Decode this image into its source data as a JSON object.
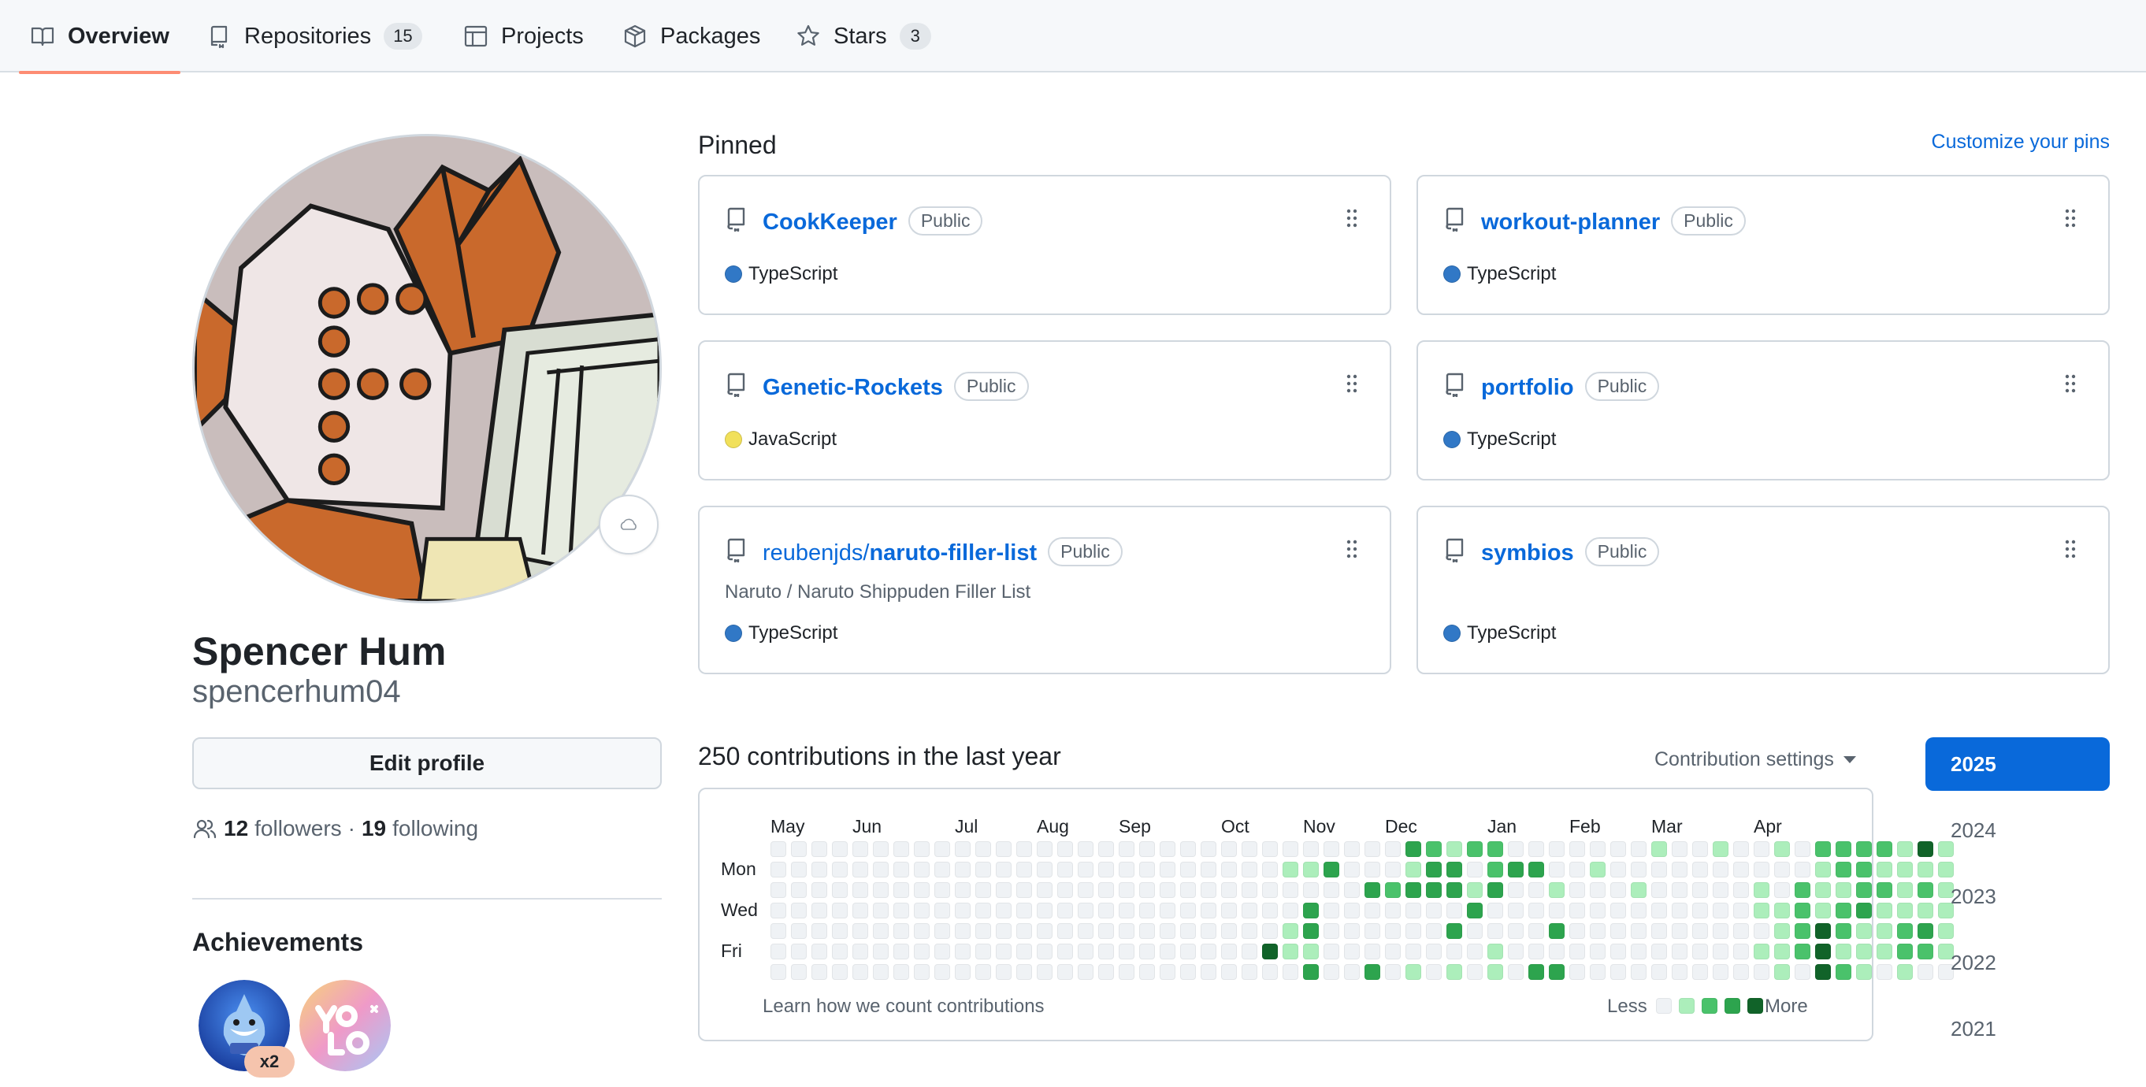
{
  "nav": {
    "tabs": [
      {
        "label": "Overview",
        "icon": "book-icon",
        "active": true
      },
      {
        "label": "Repositories",
        "icon": "repo-icon",
        "count": "15"
      },
      {
        "label": "Projects",
        "icon": "table-icon"
      },
      {
        "label": "Packages",
        "icon": "package-icon"
      },
      {
        "label": "Stars",
        "icon": "star-icon",
        "count": "3"
      }
    ]
  },
  "profile": {
    "name": "Spencer Hum",
    "login": "spencerhum04",
    "edit_label": "Edit profile",
    "followers_count": "12",
    "followers_label": "followers",
    "separator": "·",
    "following_count": "19",
    "following_label": "following",
    "achievements_title": "Achievements",
    "achievements": [
      {
        "name": "shark-badge",
        "count": "x2"
      },
      {
        "name": "yolo-badge"
      }
    ]
  },
  "pinned": {
    "title": "Pinned",
    "customize_label": "Customize your pins",
    "repos": [
      {
        "owner": "",
        "name": "CookKeeper",
        "visibility": "Public",
        "description": "",
        "language": "TypeScript",
        "lang_color": "#3178c6"
      },
      {
        "owner": "",
        "name": "workout-planner",
        "visibility": "Public",
        "description": "",
        "language": "TypeScript",
        "lang_color": "#3178c6"
      },
      {
        "owner": "",
        "name": "Genetic-Rockets",
        "visibility": "Public",
        "description": "",
        "language": "JavaScript",
        "lang_color": "#f1e05a"
      },
      {
        "owner": "",
        "name": "portfolio",
        "visibility": "Public",
        "description": "",
        "language": "TypeScript",
        "lang_color": "#3178c6"
      },
      {
        "owner": "reubenjds/",
        "name": "naruto-filler-list",
        "visibility": "Public",
        "description": "Naruto / Naruto Shippuden Filler List",
        "language": "TypeScript",
        "lang_color": "#3178c6"
      },
      {
        "owner": "",
        "name": "symbios",
        "visibility": "Public",
        "description": "",
        "language": "TypeScript",
        "lang_color": "#3178c6"
      }
    ]
  },
  "contributions": {
    "title": "250 contributions in the last year",
    "settings_label": "Contribution settings",
    "months": [
      "May",
      "Jun",
      "Jul",
      "Aug",
      "Sep",
      "Oct",
      "Nov",
      "Dec",
      "Jan",
      "Feb",
      "Mar",
      "Apr"
    ],
    "day_labels": [
      "Mon",
      "Wed",
      "Fri"
    ],
    "learn_label": "Learn how we count contributions",
    "legend_less": "Less",
    "legend_more": "More",
    "level_colors": [
      "#eff2f5",
      "#aceebb",
      "#4ac26b",
      "#2da44e",
      "#116329"
    ],
    "weeks": [
      [
        0,
        0,
        0,
        0,
        0,
        0,
        0
      ],
      [
        0,
        0,
        0,
        0,
        0,
        0,
        0
      ],
      [
        0,
        0,
        0,
        0,
        0,
        0,
        0
      ],
      [
        0,
        0,
        0,
        0,
        0,
        0,
        0
      ],
      [
        0,
        0,
        0,
        0,
        0,
        0,
        0
      ],
      [
        0,
        0,
        0,
        0,
        0,
        0,
        0
      ],
      [
        0,
        0,
        0,
        0,
        0,
        0,
        0
      ],
      [
        0,
        0,
        0,
        0,
        0,
        0,
        0
      ],
      [
        0,
        0,
        0,
        0,
        0,
        0,
        0
      ],
      [
        0,
        0,
        0,
        0,
        0,
        0,
        0
      ],
      [
        0,
        0,
        0,
        0,
        0,
        0,
        0
      ],
      [
        0,
        0,
        0,
        0,
        0,
        0,
        0
      ],
      [
        0,
        0,
        0,
        0,
        0,
        0,
        0
      ],
      [
        0,
        0,
        0,
        0,
        0,
        0,
        0
      ],
      [
        0,
        0,
        0,
        0,
        0,
        0,
        0
      ],
      [
        0,
        0,
        0,
        0,
        0,
        0,
        0
      ],
      [
        0,
        0,
        0,
        0,
        0,
        0,
        0
      ],
      [
        0,
        0,
        0,
        0,
        0,
        0,
        0
      ],
      [
        0,
        0,
        0,
        0,
        0,
        0,
        0
      ],
      [
        0,
        0,
        0,
        0,
        0,
        0,
        0
      ],
      [
        0,
        0,
        0,
        0,
        0,
        0,
        0
      ],
      [
        0,
        0,
        0,
        0,
        0,
        0,
        0
      ],
      [
        0,
        0,
        0,
        0,
        0,
        0,
        0
      ],
      [
        0,
        0,
        0,
        0,
        0,
        0,
        0
      ],
      [
        0,
        0,
        0,
        0,
        0,
        4,
        0
      ],
      [
        0,
        1,
        0,
        0,
        1,
        1,
        0
      ],
      [
        0,
        1,
        0,
        3,
        3,
        1,
        3
      ],
      [
        0,
        3,
        0,
        0,
        0,
        0,
        0
      ],
      [
        0,
        0,
        0,
        0,
        0,
        0,
        0
      ],
      [
        0,
        0,
        3,
        0,
        0,
        0,
        3
      ],
      [
        0,
        0,
        2,
        0,
        0,
        0,
        0
      ],
      [
        3,
        1,
        3,
        0,
        0,
        0,
        1
      ],
      [
        2,
        3,
        3,
        0,
        0,
        0,
        0
      ],
      [
        1,
        3,
        3,
        0,
        3,
        0,
        1
      ],
      [
        2,
        0,
        1,
        3,
        0,
        0,
        0
      ],
      [
        2,
        2,
        3,
        0,
        0,
        1,
        1
      ],
      [
        0,
        3,
        0,
        0,
        0,
        0,
        0
      ],
      [
        0,
        3,
        0,
        0,
        0,
        0,
        3
      ],
      [
        0,
        0,
        1,
        0,
        3,
        0,
        3
      ],
      [
        0,
        0,
        0,
        0,
        0,
        0,
        0
      ],
      [
        0,
        1,
        0,
        0,
        0,
        0,
        0
      ],
      [
        0,
        0,
        0,
        0,
        0,
        0,
        0
      ],
      [
        0,
        0,
        1,
        0,
        0,
        0,
        0
      ],
      [
        1,
        0,
        0,
        0,
        0,
        0,
        0
      ],
      [
        0,
        0,
        0,
        0,
        0,
        0,
        0
      ],
      [
        0,
        0,
        0,
        0,
        0,
        0,
        0
      ],
      [
        1,
        0,
        0,
        0,
        0,
        0,
        0
      ],
      [
        0,
        0,
        0,
        0,
        0,
        0,
        0
      ],
      [
        0,
        0,
        1,
        1,
        0,
        1,
        0
      ],
      [
        1,
        0,
        0,
        1,
        1,
        1,
        1
      ],
      [
        0,
        0,
        2,
        2,
        2,
        2,
        0
      ],
      [
        2,
        1,
        1,
        1,
        4,
        4,
        4
      ],
      [
        2,
        2,
        1,
        2,
        2,
        1,
        2
      ],
      [
        2,
        2,
        2,
        3,
        1,
        1,
        1
      ],
      [
        2,
        1,
        2,
        1,
        1,
        1,
        0
      ],
      [
        1,
        1,
        1,
        1,
        2,
        2,
        1
      ],
      [
        4,
        1,
        2,
        1,
        3,
        2,
        0
      ],
      [
        1,
        1,
        1,
        1,
        1,
        1,
        0
      ]
    ]
  },
  "years": [
    "2025",
    "2024",
    "2023",
    "2022",
    "2021"
  ],
  "active_year": "2025"
}
